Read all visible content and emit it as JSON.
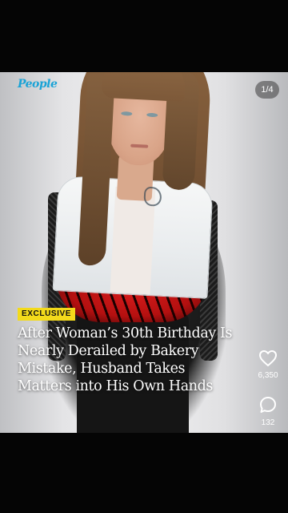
{
  "post": {
    "brand": "People",
    "page_indicator": "1/4",
    "badge": "EXCLUSIVE",
    "headline": "After Woman’s 30th Birthday Is Nearly Derailed by Bakery Mistake, Husband Takes Matters into His Own Hands"
  },
  "actions": {
    "like_count": "6,350",
    "comment_count": "132"
  },
  "icons": [
    "heart-icon",
    "comment-icon",
    "share-icon"
  ],
  "colors": {
    "brand": "#1aa3d6",
    "badge": "#f3da1b",
    "background": "#000000"
  }
}
